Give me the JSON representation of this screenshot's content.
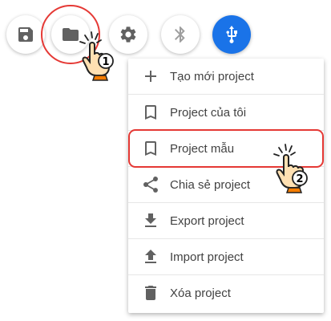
{
  "toolbar": {
    "buttons": [
      {
        "icon": "save-icon",
        "bg": "#ffffff"
      },
      {
        "icon": "folder-icon",
        "bg": "#ffffff"
      },
      {
        "icon": "gear-icon",
        "bg": "#ffffff"
      },
      {
        "icon": "bluetooth-icon",
        "bg": "#ffffff"
      },
      {
        "icon": "usb-icon",
        "bg": "#1a73e8"
      }
    ]
  },
  "menu": {
    "items": [
      {
        "label": "Tạo mới project",
        "icon": "plus-icon"
      },
      {
        "label": "Project của tôi",
        "icon": "bookmark-icon"
      },
      {
        "label": "Project mẫu",
        "icon": "bookmark-icon"
      },
      {
        "label": "Chia sẻ project",
        "icon": "share-icon"
      },
      {
        "label": "Export project",
        "icon": "download-icon"
      },
      {
        "label": "Import project",
        "icon": "upload-icon"
      },
      {
        "label": "Xóa project",
        "icon": "trash-icon"
      }
    ]
  },
  "annotations": {
    "step1": "1",
    "step2": "2",
    "highlight_color": "#e53935",
    "hand_color": "#ffe0b2",
    "cuff_color": "#f57c00"
  }
}
